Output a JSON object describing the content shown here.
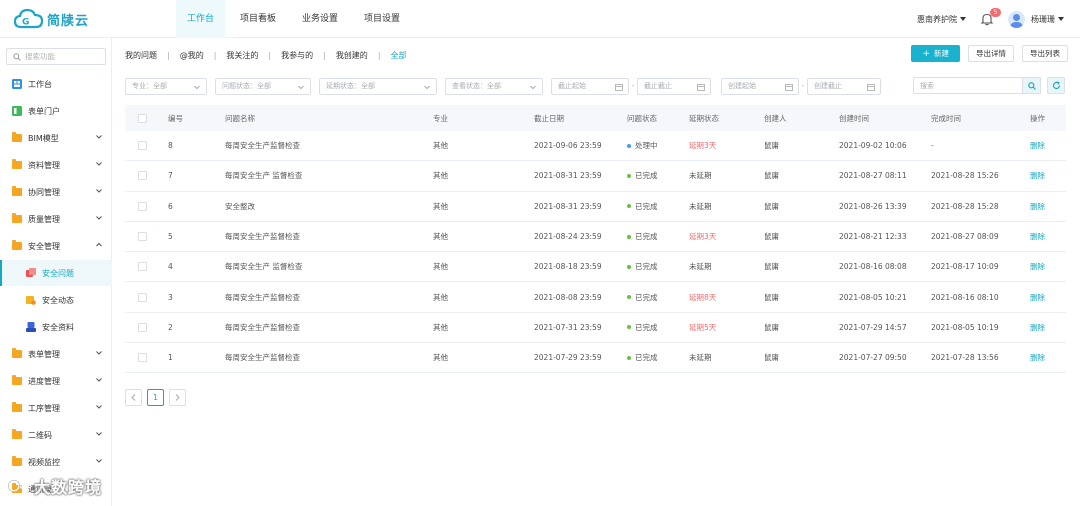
{
  "brand": {
    "name": "简牍云",
    "accent": "#16a7c2"
  },
  "topnav": [
    {
      "label": "工作台",
      "active": true
    },
    {
      "label": "项目看板"
    },
    {
      "label": "业务设置"
    },
    {
      "label": "项目设置"
    }
  ],
  "header": {
    "org": "惠南养护院",
    "notif_count": "5",
    "username": "杨珊珊"
  },
  "sidebar": {
    "search_placeholder": "搜索功能",
    "items": [
      {
        "label": "工作台"
      },
      {
        "label": "表单门户"
      },
      {
        "label": "BIM模型"
      },
      {
        "label": "资料管理"
      },
      {
        "label": "协同管理"
      },
      {
        "label": "质量管理"
      },
      {
        "label": "安全管理"
      },
      {
        "label": "安全问题"
      },
      {
        "label": "安全动态"
      },
      {
        "label": "安全资料"
      },
      {
        "label": "表单管理"
      },
      {
        "label": "进度管理"
      },
      {
        "label": "工序管理"
      },
      {
        "label": "二维码"
      },
      {
        "label": "视频监控"
      },
      {
        "label": "通讯录"
      }
    ]
  },
  "tabs": [
    "我的问题",
    "@我的",
    "我关注的",
    "我参与的",
    "我创建的",
    "全部"
  ],
  "actions": {
    "new": "新建",
    "export_detail": "导出详情",
    "export_list": "导出列表"
  },
  "filters": {
    "major": "专业：全部",
    "issue_status": "问题状态：全部",
    "delay_status": "延期状态：全部",
    "view_status": "查看状态：全部",
    "deadline_start": "截止起始",
    "deadline_end": "截止截止",
    "created_start": "创建起始",
    "created_end": "创建截止",
    "search_placeholder": "搜索"
  },
  "table": {
    "headers": [
      "编号",
      "问题名称",
      "专业",
      "截止日期",
      "问题状态",
      "延期状态",
      "创建人",
      "创建时间",
      "完成时间",
      "操作"
    ],
    "rows": [
      {
        "no": "8",
        "name": "每周安全生产监督检查",
        "major": "其他",
        "deadline": "2021-09-06 23:59",
        "status": "处理中",
        "status_color": "#409eff",
        "delay": "延期3天",
        "delay_red": true,
        "creator": "鼠庸",
        "created": "2021-09-02 10:06",
        "finished": "-",
        "op": "删除"
      },
      {
        "no": "7",
        "name": "每周安全生产 监督检查",
        "major": "其他",
        "deadline": "2021-08-31 23:59",
        "status": "已完成",
        "status_color": "#67c23a",
        "delay": "未延期",
        "delay_red": false,
        "creator": "鼠庸",
        "created": "2021-08-27 08:11",
        "finished": "2021-08-28 15:26",
        "op": "删除"
      },
      {
        "no": "6",
        "name": "安全整改",
        "major": "其他",
        "deadline": "2021-08-31 23:59",
        "status": "已完成",
        "status_color": "#67c23a",
        "delay": "未延期",
        "delay_red": false,
        "creator": "鼠庸",
        "created": "2021-08-26 13:39",
        "finished": "2021-08-28 15:28",
        "op": "删除"
      },
      {
        "no": "5",
        "name": "每周安全生产监督检查",
        "major": "其他",
        "deadline": "2021-08-24 23:59",
        "status": "已完成",
        "status_color": "#67c23a",
        "delay": "延期3天",
        "delay_red": true,
        "creator": "鼠庸",
        "created": "2021-08-21 12:33",
        "finished": "2021-08-27 08:09",
        "op": "删除"
      },
      {
        "no": "4",
        "name": "每周安全生产 监督检查",
        "major": "其他",
        "deadline": "2021-08-18 23:59",
        "status": "已完成",
        "status_color": "#67c23a",
        "delay": "未延期",
        "delay_red": false,
        "creator": "鼠庸",
        "created": "2021-08-16 08:08",
        "finished": "2021-08-17 10:09",
        "op": "删除"
      },
      {
        "no": "3",
        "name": "每周安全生产监督检查",
        "major": "其他",
        "deadline": "2021-08-08 23:59",
        "status": "已完成",
        "status_color": "#67c23a",
        "delay": "延期8天",
        "delay_red": true,
        "creator": "鼠庸",
        "created": "2021-08-05 10:21",
        "finished": "2021-08-16 08:10",
        "op": "删除"
      },
      {
        "no": "2",
        "name": "每周安全生产监督检查",
        "major": "其他",
        "deadline": "2021-07-31 23:59",
        "status": "已完成",
        "status_color": "#67c23a",
        "delay": "延期5天",
        "delay_red": true,
        "creator": "鼠庸",
        "created": "2021-07-29 14:57",
        "finished": "2021-08-05 10:19",
        "op": "删除"
      },
      {
        "no": "1",
        "name": "每周安全生产监督检查",
        "major": "其他",
        "deadline": "2021-07-29 23:59",
        "status": "已完成",
        "status_color": "#67c23a",
        "delay": "未延期",
        "delay_red": false,
        "creator": "鼠庸",
        "created": "2021-07-27 09:50",
        "finished": "2021-07-28 13:56",
        "op": "删除"
      }
    ]
  },
  "pager": {
    "current": "1"
  },
  "watermark": {
    "text": "大数跨境"
  }
}
